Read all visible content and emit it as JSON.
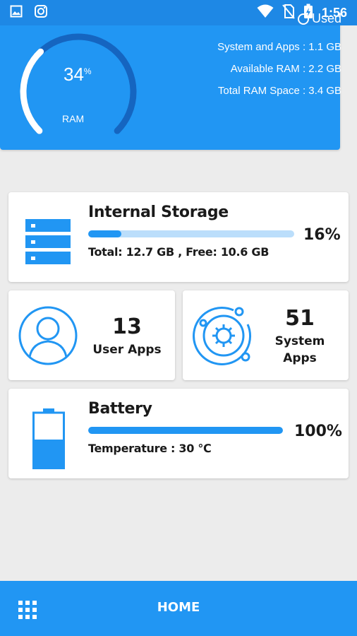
{
  "status_bar": {
    "time": "1:56",
    "icons": [
      "image-icon",
      "instagram-icon",
      "wifi-icon",
      "no-sim-icon",
      "battery-charging-icon"
    ]
  },
  "ram": {
    "percent_value": "34",
    "percent_sign": "%",
    "label": "RAM",
    "used_fraction": 0.34,
    "legend_label": "Used",
    "stats": [
      "System and Apps : 1.1 GB",
      "Available RAM : 2.2 GB",
      "Total RAM Space : 3.4 GB"
    ]
  },
  "storage": {
    "title": "Internal Storage",
    "percent_text": "16%",
    "used_fraction": 0.16,
    "total_free_text": "Total:  12.7 GB ,  Free: 10.6 GB"
  },
  "user_apps": {
    "count": "13",
    "label": "User Apps"
  },
  "system_apps": {
    "count": "51",
    "label_line1": "System",
    "label_line2": "Apps"
  },
  "battery": {
    "title": "Battery",
    "percent_text": "100%",
    "level_fraction": 1.0,
    "temperature_text": "Temperature : 30 ℃"
  },
  "bottom_nav": {
    "home_label": "HOME"
  },
  "colors": {
    "accent": "#2196f3",
    "accent_dark": "#1e88e5",
    "track": "#bbdefb",
    "gauge_dark": "#1565c0"
  }
}
